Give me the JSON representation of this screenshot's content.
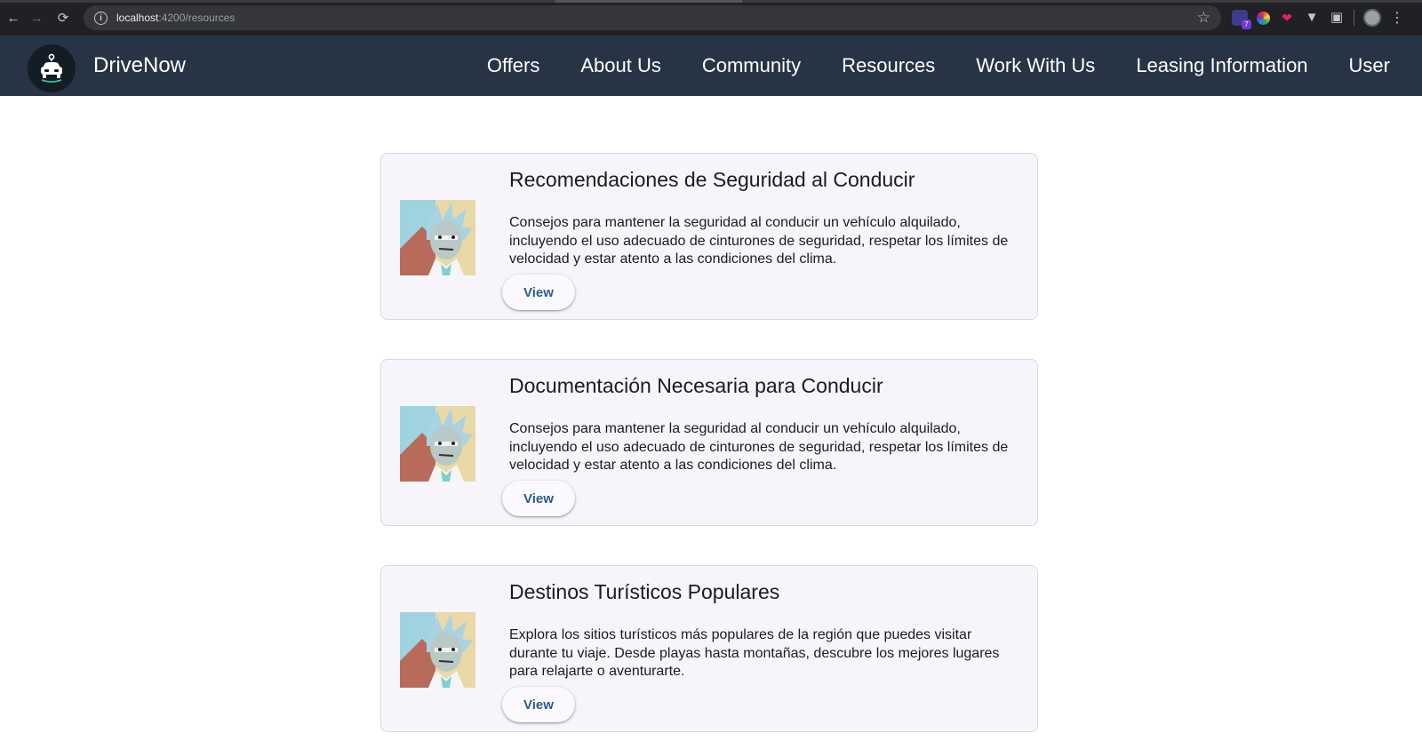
{
  "browser": {
    "url_host": "localhost",
    "url_path": ":4200/resources",
    "ext_badge": "7",
    "icons": {
      "back": "arrow-left",
      "forward": "arrow-right",
      "reload": "reload",
      "info": "info",
      "bookmark": "star",
      "extensions": "puzzle",
      "menu": "vertical-dots"
    }
  },
  "header": {
    "brand": "DriveNow",
    "logo_icon": "car-icon",
    "nav": [
      "Offers",
      "About Us",
      "Community",
      "Resources",
      "Work With Us",
      "Leasing Information",
      "User"
    ]
  },
  "cards": [
    {
      "title": "Recomendaciones de Seguridad al Conducir",
      "description": "Consejos para mantener la seguridad al conducir un vehículo alquilado, incluyendo el uso adecuado de cinturones de seguridad, respetar los límites de velocidad y estar atento a las condiciones del clima.",
      "button": "View"
    },
    {
      "title": "Documentación Necesaria para Conducir",
      "description": "Consejos para mantener la seguridad al conducir un vehículo alquilado, incluyendo el uso adecuado de cinturones de seguridad, respetar los límites de velocidad y estar atento a las condiciones del clima.",
      "button": "View"
    },
    {
      "title": "Destinos Turísticos Populares",
      "description": "Explora los sitios turísticos más populares de la región que puedes visitar durante tu viaje. Desde playas hasta montañas, descubre los mejores lugares para relajarte o aventurarte.",
      "button": "View"
    }
  ],
  "colors": {
    "header_bg": "#263445",
    "browser_bg": "#202124",
    "card_bg": "#f7f5fb",
    "button_text": "#2c5a8a"
  }
}
